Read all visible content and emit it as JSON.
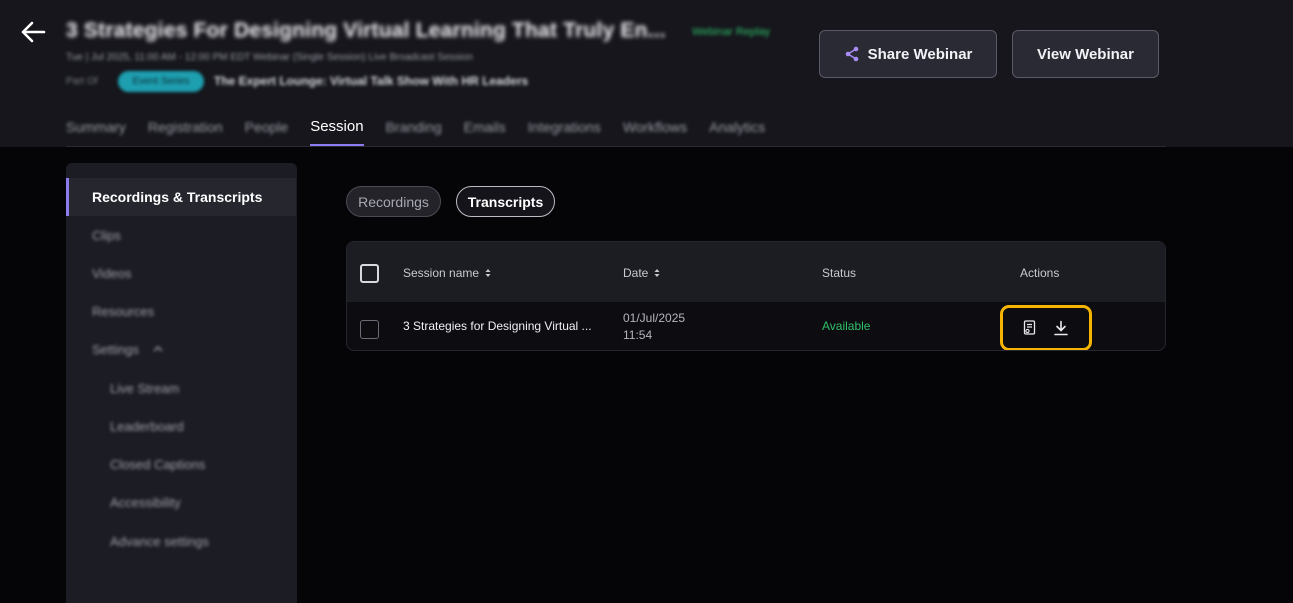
{
  "header": {
    "title": "3 Strategies For Designing Virtual Learning That Truly En...",
    "status": "Webinar Replay",
    "meta": "Tue | Jul 2025, 11:00 AM - 12:00 PM EDT  Webinar (Single Session)  Live Broadcast Session",
    "part_label": "Part Of",
    "series_badge": "Event Series",
    "series_name": "The Expert Lounge: Virtual Talk Show With HR Leaders",
    "share_label": "Share Webinar",
    "view_label": "View Webinar"
  },
  "tabs": [
    {
      "label": "Summary"
    },
    {
      "label": "Registration"
    },
    {
      "label": "People"
    },
    {
      "label": "Session",
      "active": true
    },
    {
      "label": "Branding"
    },
    {
      "label": "Emails"
    },
    {
      "label": "Integrations"
    },
    {
      "label": "Workflows"
    },
    {
      "label": "Analytics"
    }
  ],
  "sidebar": {
    "items": [
      {
        "label": "Recordings & Transcripts",
        "active": true
      },
      {
        "label": "Clips"
      },
      {
        "label": "Videos"
      },
      {
        "label": "Resources"
      },
      {
        "label": "Settings"
      },
      {
        "label": "Live Stream"
      },
      {
        "label": "Leaderboard"
      },
      {
        "label": "Closed Captions"
      },
      {
        "label": "Accessibility"
      },
      {
        "label": "Advance settings"
      }
    ]
  },
  "segments": {
    "recordings": "Recordings",
    "transcripts": "Transcripts",
    "selected": "Transcripts"
  },
  "table": {
    "columns": [
      "Session name",
      "Date",
      "Status",
      "Actions"
    ],
    "rows": [
      {
        "session_name": "3 Strategies for Designing Virtual ...",
        "date": "01/Jul/2025",
        "time": "11:54",
        "status": "Available",
        "actions": [
          "transcript-icon",
          "download-icon"
        ]
      }
    ]
  },
  "colors": {
    "accent": "#8b7cf0",
    "status_available": "#2fbf6a",
    "highlight": "#f5b400"
  }
}
